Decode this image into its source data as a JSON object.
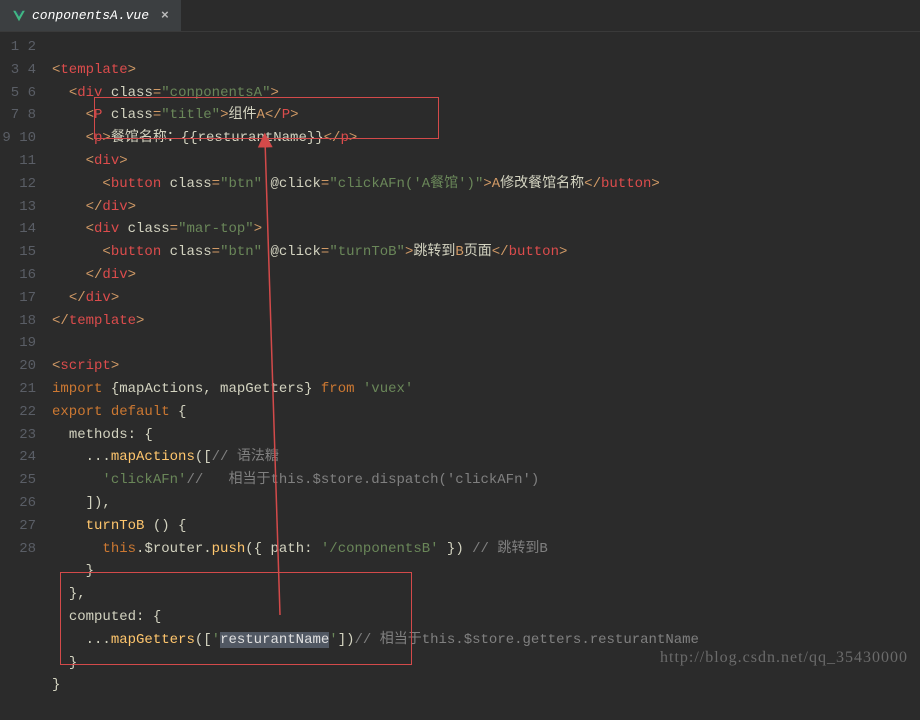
{
  "tab": {
    "filename": "conponentsA.vue"
  },
  "lines": [
    "1",
    "2",
    "3",
    "4",
    "5",
    "6",
    "7",
    "8",
    "9",
    "10",
    "11",
    "12",
    "13",
    "14",
    "15",
    "16",
    "17",
    "18",
    "19",
    "20",
    "21",
    "22",
    "23",
    "24",
    "25",
    "26",
    "27",
    "28"
  ],
  "code": {
    "l1_open": "<",
    "l1_tag": "template",
    "l1_close": ">",
    "l2_open": "<",
    "l2_tag": "div",
    "l2_attr": "class",
    "l2_eq": "=",
    "l2_val": "\"conponentsA\"",
    "l2_close": ">",
    "l3_open": "<",
    "l3_tag": "P",
    "l3_attr": "class",
    "l3_eq": "=",
    "l3_val": "\"title\"",
    "l3_close": ">",
    "l3_text": "组件",
    "l3_textA": "A",
    "l3_end_open": "</",
    "l3_end_tag": "P",
    "l3_end_close": ">",
    "l4_open": "<",
    "l4_tag": "p",
    "l4_close": ">",
    "l4_text": "餐馆名称：{{resturantName}}",
    "l4_end_open": "</",
    "l4_end_tag": "p",
    "l4_end_close": ">",
    "l5_open": "<",
    "l5_tag": "div",
    "l5_close": ">",
    "l6_open": "<",
    "l6_tag": "button",
    "l6_a1": "class",
    "l6_eq1": "=",
    "l6_v1": "\"btn\"",
    "l6_a2": "@click",
    "l6_eq2": "=",
    "l6_v2": "\"clickAFn('A餐馆')\"",
    "l6_close": ">",
    "l6_textA": "A",
    "l6_text": "修改餐馆名称",
    "l6_end_open": "</",
    "l6_end_tag": "button",
    "l6_end_close": ">",
    "l7_open": "</",
    "l7_tag": "div",
    "l7_close": ">",
    "l8_open": "<",
    "l8_tag": "div",
    "l8_a1": "class",
    "l8_eq1": "=",
    "l8_v1": "\"mar-top\"",
    "l8_close": ">",
    "l9_open": "<",
    "l9_tag": "button",
    "l9_a1": "class",
    "l9_eq1": "=",
    "l9_v1": "\"btn\"",
    "l9_a2": "@click",
    "l9_eq2": "=",
    "l9_v2": "\"turnToB\"",
    "l9_close": ">",
    "l9_text": "跳转到",
    "l9_textB": "B",
    "l9_text2": "页面",
    "l9_end_open": "</",
    "l9_end_tag": "button",
    "l9_end_close": ">",
    "l10_open": "</",
    "l10_tag": "div",
    "l10_close": ">",
    "l11_open": "</",
    "l11_tag": "div",
    "l11_close": ">",
    "l12_open": "</",
    "l12_tag": "template",
    "l12_close": ">",
    "l14_open": "<",
    "l14_tag": "script",
    "l14_close": ">",
    "l15_imp": "import",
    "l15_brace_o": " {",
    "l15_names": "mapActions, mapGetters",
    "l15_brace_c": "}",
    "l15_from": " from ",
    "l15_mod": "'vuex'",
    "l16_exp": "export ",
    "l16_def": "default",
    "l16_brace": " {",
    "l17_key": "methods",
    "l17_rest": ": {",
    "l18_spread": "...",
    "l18_fn": "mapActions",
    "l18_open": "([",
    "l18_cmt": "// 语法糖",
    "l19_item": "'clickAFn'",
    "l19_cmt": "//   相当于this.$store.dispatch('clickAFn')",
    "l20_close": "]),",
    "l21_fn": "turnToB",
    "l21_sig": " () {",
    "l22_this": "this",
    "l22_dot1": ".",
    "l22_router": "$router",
    "l22_dot2": ".",
    "l22_push": "push",
    "l22_open": "({ ",
    "l22_pathk": "path",
    "l22_colon": ": ",
    "l22_path": "'/conponentsB'",
    "l22_close": " })",
    "l22_cmt": " // 跳转到B",
    "l23_close": "}",
    "l24_close": "},",
    "l25_key": "computed",
    "l25_rest": ": {",
    "l26_spread": "...",
    "l26_fn": "mapGetters",
    "l26_open": "([",
    "l26_q1": "'",
    "l26_id": "resturantName",
    "l26_q2": "'",
    "l26_close": "])",
    "l26_cmt": "// 相当于this.$store.getters.resturantName",
    "l27_close": "}",
    "l28_close": "}"
  },
  "watermark": "http://blog.csdn.net/qq_35430000"
}
